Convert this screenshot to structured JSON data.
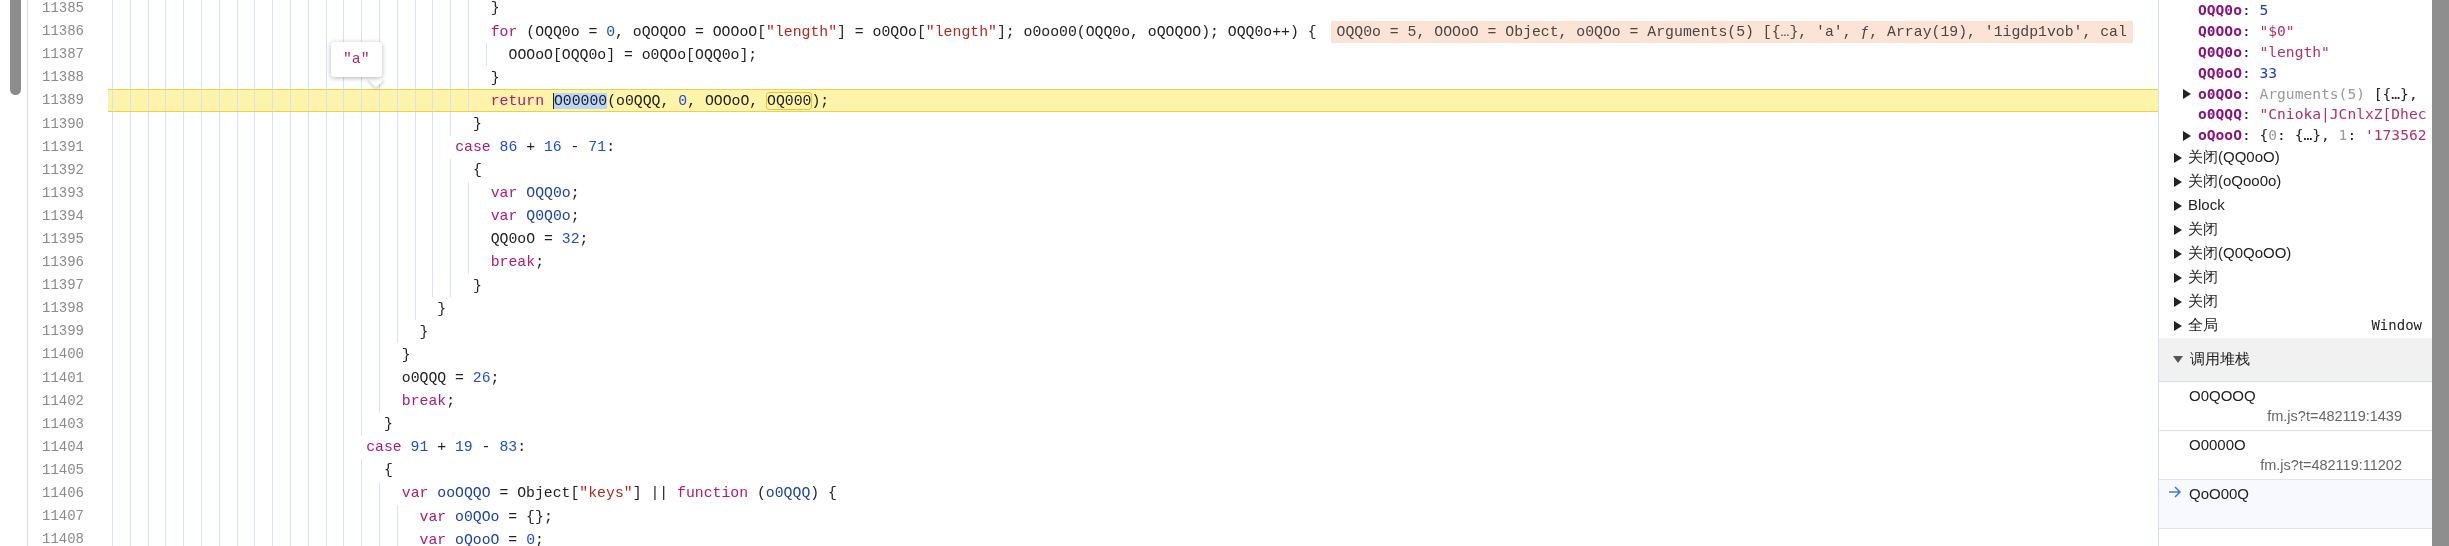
{
  "editor": {
    "lines": [
      {
        "number": "11385",
        "highlighted": false,
        "tokens": [
          {
            "text": "                                          }",
            "kind": "plain"
          }
        ]
      },
      {
        "number": "11386",
        "highlighted": false,
        "tokens": [
          {
            "text": "                                          for",
            "kind": "keyword"
          },
          {
            "text": " (OQQ0o = ",
            "kind": "plain"
          },
          {
            "text": "0",
            "kind": "number"
          },
          {
            "text": ", oQOQOO = OOOoO[",
            "kind": "plain"
          },
          {
            "text": "\"length\"",
            "kind": "string"
          },
          {
            "text": "] = o0QOo[",
            "kind": "plain"
          },
          {
            "text": "\"length\"",
            "kind": "string"
          },
          {
            "text": "]; o0oo00(OQQ0o, oQOQOO); OQQ0o++) {",
            "kind": "plain"
          }
        ],
        "inline_values": "OQQ0o = 5, OOOoO = Object, o0QOo = Arguments(5) [{…}, 'a', ƒ, Array(19), '1igdp1vob', cal"
      },
      {
        "number": "11387",
        "highlighted": false,
        "tokens": [
          {
            "text": "                                            OOOoO[OQQ0o] = o0QOo[OQQ0o];",
            "kind": "plain"
          }
        ]
      },
      {
        "number": "11388",
        "highlighted": false,
        "tokens": [
          {
            "text": "                                          }",
            "kind": "plain"
          }
        ]
      },
      {
        "number": "11389",
        "highlighted": true,
        "tokens": [
          {
            "text": "                                          return ",
            "kind": "keyword"
          },
          {
            "text": "O00000",
            "kind": "selection"
          },
          {
            "text": "(o0QQQ, ",
            "kind": "plain"
          },
          {
            "text": "0",
            "kind": "number"
          },
          {
            "text": ", OOOoO, ",
            "kind": "plain"
          },
          {
            "text": "OQ000",
            "kind": "hover",
            "tooltip": "\"a\""
          },
          {
            "text": ");",
            "kind": "plain"
          }
        ]
      },
      {
        "number": "11390",
        "highlighted": false,
        "tokens": [
          {
            "text": "                                        }",
            "kind": "plain"
          }
        ]
      },
      {
        "number": "11391",
        "highlighted": false,
        "tokens": [
          {
            "text": "                                      case ",
            "kind": "keyword"
          },
          {
            "text": "86",
            "kind": "number"
          },
          {
            "text": " + ",
            "kind": "plain"
          },
          {
            "text": "16",
            "kind": "number"
          },
          {
            "text": " - ",
            "kind": "plain"
          },
          {
            "text": "71",
            "kind": "number"
          },
          {
            "text": ":",
            "kind": "plain"
          }
        ]
      },
      {
        "number": "11392",
        "highlighted": false,
        "tokens": [
          {
            "text": "                                        {",
            "kind": "plain"
          }
        ]
      },
      {
        "number": "11393",
        "highlighted": false,
        "tokens": [
          {
            "text": "                                          var ",
            "kind": "keyword"
          },
          {
            "text": "OQQ0o",
            "kind": "variable"
          },
          {
            "text": ";",
            "kind": "plain"
          }
        ]
      },
      {
        "number": "11394",
        "highlighted": false,
        "tokens": [
          {
            "text": "                                          var ",
            "kind": "keyword"
          },
          {
            "text": "Q0Q0o",
            "kind": "variable"
          },
          {
            "text": ";",
            "kind": "plain"
          }
        ]
      },
      {
        "number": "11395",
        "highlighted": false,
        "tokens": [
          {
            "text": "                                          QQ0oO = ",
            "kind": "plain"
          },
          {
            "text": "32",
            "kind": "number"
          },
          {
            "text": ";",
            "kind": "plain"
          }
        ]
      },
      {
        "number": "11396",
        "highlighted": false,
        "tokens": [
          {
            "text": "                                          break",
            "kind": "keyword"
          },
          {
            "text": ";",
            "kind": "plain"
          }
        ]
      },
      {
        "number": "11397",
        "highlighted": false,
        "tokens": [
          {
            "text": "                                        }",
            "kind": "plain"
          }
        ]
      },
      {
        "number": "11398",
        "highlighted": false,
        "tokens": [
          {
            "text": "                                    }",
            "kind": "plain"
          }
        ]
      },
      {
        "number": "11399",
        "highlighted": false,
        "tokens": [
          {
            "text": "                                  }",
            "kind": "plain"
          }
        ]
      },
      {
        "number": "11400",
        "highlighted": false,
        "tokens": [
          {
            "text": "                                }",
            "kind": "plain"
          }
        ]
      },
      {
        "number": "11401",
        "highlighted": false,
        "tokens": [
          {
            "text": "                                o0QQQ = ",
            "kind": "plain"
          },
          {
            "text": "26",
            "kind": "number"
          },
          {
            "text": ";",
            "kind": "plain"
          }
        ]
      },
      {
        "number": "11402",
        "highlighted": false,
        "tokens": [
          {
            "text": "                                break",
            "kind": "keyword"
          },
          {
            "text": ";",
            "kind": "plain"
          }
        ]
      },
      {
        "number": "11403",
        "highlighted": false,
        "tokens": [
          {
            "text": "                              }",
            "kind": "plain"
          }
        ]
      },
      {
        "number": "11404",
        "highlighted": false,
        "tokens": [
          {
            "text": "                            case ",
            "kind": "keyword"
          },
          {
            "text": "91",
            "kind": "number"
          },
          {
            "text": " + ",
            "kind": "plain"
          },
          {
            "text": "19",
            "kind": "number"
          },
          {
            "text": " - ",
            "kind": "plain"
          },
          {
            "text": "83",
            "kind": "number"
          },
          {
            "text": ":",
            "kind": "plain"
          }
        ]
      },
      {
        "number": "11405",
        "highlighted": false,
        "tokens": [
          {
            "text": "                              {",
            "kind": "plain"
          }
        ]
      },
      {
        "number": "11406",
        "highlighted": false,
        "tokens": [
          {
            "text": "                                var ",
            "kind": "keyword"
          },
          {
            "text": "ooOQQO",
            "kind": "variable"
          },
          {
            "text": " = Object[",
            "kind": "plain"
          },
          {
            "text": "\"keys\"",
            "kind": "string"
          },
          {
            "text": "] || ",
            "kind": "plain"
          },
          {
            "text": "function",
            "kind": "keyword"
          },
          {
            "text": " (",
            "kind": "plain"
          },
          {
            "text": "o0QQQ",
            "kind": "variable"
          },
          {
            "text": ") {",
            "kind": "plain"
          }
        ]
      },
      {
        "number": "11407",
        "highlighted": false,
        "tokens": [
          {
            "text": "                                  var ",
            "kind": "keyword"
          },
          {
            "text": "o0QOo",
            "kind": "variable"
          },
          {
            "text": " = {};",
            "kind": "plain"
          }
        ]
      },
      {
        "number": "11408",
        "highlighted": false,
        "tokens": [
          {
            "text": "                                  var ",
            "kind": "keyword"
          },
          {
            "text": "oQooO",
            "kind": "variable"
          },
          {
            "text": " = ",
            "kind": "plain"
          },
          {
            "text": "0",
            "kind": "number"
          },
          {
            "text": ";",
            "kind": "plain"
          }
        ]
      }
    ]
  },
  "scope": {
    "variables": [
      {
        "name": "OQQ0o",
        "expandable": false,
        "value": [
          {
            "text": ": ",
            "kind": "plain"
          },
          {
            "text": "5",
            "kind": "number"
          }
        ]
      },
      {
        "name": "Q0OOo",
        "expandable": false,
        "value": [
          {
            "text": ": ",
            "kind": "plain"
          },
          {
            "text": "\"$0\"",
            "kind": "string"
          }
        ]
      },
      {
        "name": "Q0Q0o",
        "expandable": false,
        "value": [
          {
            "text": ": ",
            "kind": "plain"
          },
          {
            "text": "\"length\"",
            "kind": "string"
          }
        ]
      },
      {
        "name": "QQ0oO",
        "expandable": false,
        "value": [
          {
            "text": ": ",
            "kind": "plain"
          },
          {
            "text": "33",
            "kind": "number"
          }
        ]
      },
      {
        "name": "o0QOo",
        "expandable": true,
        "value": [
          {
            "text": ": ",
            "kind": "plain"
          },
          {
            "text": "Arguments(5)",
            "kind": "dim"
          },
          {
            "text": " [{…},",
            "kind": "plain"
          }
        ]
      },
      {
        "name": "o0QQQ",
        "expandable": false,
        "value": [
          {
            "text": ": ",
            "kind": "plain"
          },
          {
            "text": "\"Cnioka|JCnlxZ[Dhec",
            "kind": "string"
          }
        ]
      },
      {
        "name": "oQooO",
        "expandable": true,
        "value": [
          {
            "text": ": {",
            "kind": "plain"
          },
          {
            "text": "0",
            "kind": "dim"
          },
          {
            "text": ": {…}, ",
            "kind": "plain"
          },
          {
            "text": "1",
            "kind": "dim"
          },
          {
            "text": ": ",
            "kind": "plain"
          },
          {
            "text": "'173562",
            "kind": "string"
          }
        ]
      }
    ],
    "sections": [
      {
        "label": "关闭(QQ0oO)",
        "expanded": false
      },
      {
        "label": "关闭(oQoo0o)",
        "expanded": false
      },
      {
        "label": "Block",
        "expanded": false
      },
      {
        "label": "关闭",
        "expanded": false
      },
      {
        "label": "关闭(Q0QoOO)",
        "expanded": false
      },
      {
        "label": "关闭",
        "expanded": false
      },
      {
        "label": "关闭",
        "expanded": false
      },
      {
        "label": "全局",
        "expanded": false,
        "value": "Window"
      }
    ]
  },
  "call_stack": {
    "title": "调用堆栈",
    "expanded": true,
    "frames": [
      {
        "function": "O0QOOQ",
        "location": "fm.js?t=482119:1439",
        "selected": false
      },
      {
        "function": "O0000O",
        "location": "fm.js?t=482119:11202",
        "selected": false
      },
      {
        "function": "QoO00Q",
        "selected": true
      }
    ]
  }
}
